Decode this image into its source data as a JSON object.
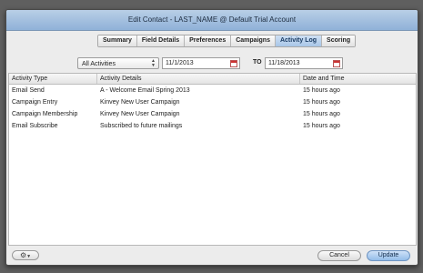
{
  "window": {
    "title": "Edit Contact - LAST_NAME @ Default Trial Account"
  },
  "tabs": [
    {
      "label": "Summary",
      "active": false
    },
    {
      "label": "Field Details",
      "active": false
    },
    {
      "label": "Preferences",
      "active": false
    },
    {
      "label": "Campaigns",
      "active": false
    },
    {
      "label": "Activity Log",
      "active": true
    },
    {
      "label": "Scoring",
      "active": false
    }
  ],
  "filter": {
    "activity_select": "All Activities",
    "from_date": "11/1/2013",
    "to_label": "TO",
    "to_date": "11/18/2013"
  },
  "table": {
    "headers": [
      "Activity Type",
      "Activity Details",
      "Date and Time"
    ],
    "rows": [
      [
        "Email Send",
        "A - Welcome Email Spring 2013",
        "15 hours ago"
      ],
      [
        "Campaign Entry",
        "Kinvey New User Campaign",
        "15 hours ago"
      ],
      [
        "Campaign Membership",
        "Kinvey New User Campaign",
        "15 hours ago"
      ],
      [
        "Email Subscribe",
        "Subscribed to future mailings",
        "15 hours ago"
      ]
    ]
  },
  "footer": {
    "gear_icon": "gear-icon",
    "cancel_label": "Cancel",
    "update_label": "Update"
  },
  "colors": {
    "accent": "#a8c6e8",
    "titlebar": "#8fb1d8"
  }
}
